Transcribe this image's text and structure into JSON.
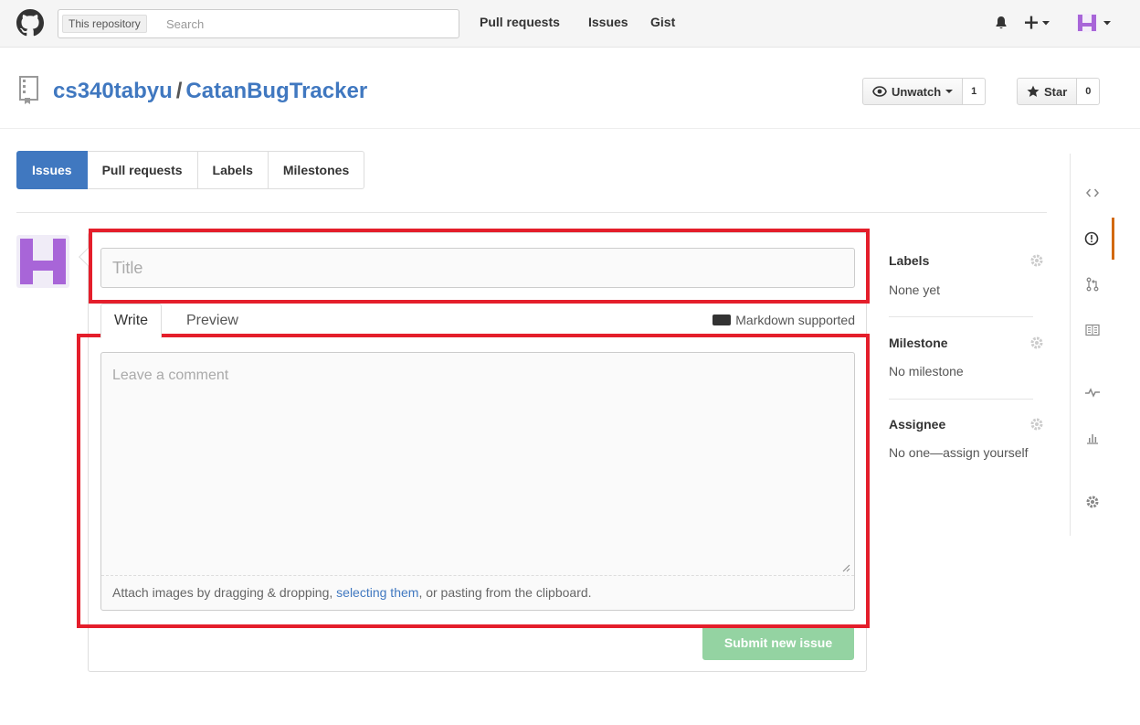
{
  "header": {
    "search_scope": "This repository",
    "search_placeholder": "Search",
    "nav": [
      "Pull requests",
      "Issues",
      "Gist"
    ],
    "icons": [
      "octocat-logo-icon",
      "bell-icon",
      "plus-icon",
      "caret-down-icon",
      "avatar-icon",
      "caret-down-icon"
    ]
  },
  "repo": {
    "owner": "cs340tabyu",
    "separator": "/",
    "name": "CatanBugTracker",
    "icon": "repo-book-icon",
    "watch_label": "Unwatch",
    "watch_count": "1",
    "star_label": "Star",
    "star_count": "0"
  },
  "subnav": {
    "items": [
      "Issues",
      "Pull requests",
      "Labels",
      "Milestones"
    ],
    "active": "Issues"
  },
  "form": {
    "title_placeholder": "Title",
    "tabs": [
      "Write",
      "Preview"
    ],
    "active_tab": "Write",
    "markdown_note": "Markdown supported",
    "comment_placeholder": "Leave a comment",
    "attach_prefix": "Attach images by dragging & dropping, ",
    "attach_link": "selecting them",
    "attach_suffix": ", or pasting from the clipboard.",
    "submit_label": "Submit new issue"
  },
  "sidebar": {
    "labels_title": "Labels",
    "labels_value": "None yet",
    "milestone_title": "Milestone",
    "milestone_value": "No milestone",
    "assignee_title": "Assignee",
    "assignee_value": "No one—assign yourself"
  },
  "repo_nav": {
    "icons": [
      "code-icon",
      "issue-icon",
      "pull-request-icon",
      "wiki-icon",
      "pulse-icon",
      "graphs-icon",
      "settings-icon"
    ],
    "active": "issue-icon"
  },
  "colors": {
    "accent": "#4078c0",
    "highlight": "#e41e2b",
    "submit_disabled": "#94d3a2",
    "avatar": "#a865d8",
    "active_nav": "#d26911"
  }
}
